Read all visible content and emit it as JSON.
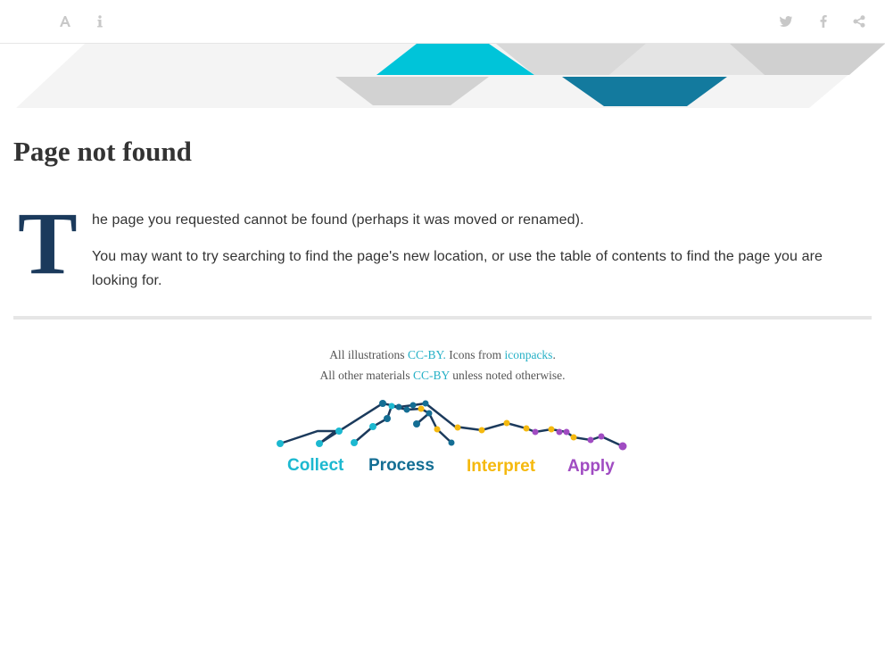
{
  "toolbar": {
    "left_icons": [
      "font-size-icon",
      "info-icon"
    ],
    "right_icons": [
      "twitter-icon",
      "facebook-icon",
      "share-icon"
    ],
    "icon_color": "#c8c8c8"
  },
  "page": {
    "title": "Page not found",
    "dropcap": "T",
    "para1_rest": "he page you requested cannot be found (perhaps it was moved or renamed).",
    "para2": "You may want to try searching to find the page's new location, or use the table of contents to find the page you are looking for."
  },
  "credits": {
    "line1_prefix": "All illustrations ",
    "line1_link1": "CC-BY.",
    "line1_mid": " Icons from ",
    "line1_link2": "iconpacks",
    "line1_suffix": ".",
    "line2_prefix": "All other materials ",
    "line2_link": "CC-BY",
    "line2_suffix": " unless noted otherwise."
  },
  "logo": {
    "words": [
      "Collect",
      "Process",
      "Interpret",
      "Apply"
    ],
    "colors": {
      "collect": "#1cb8d0",
      "process": "#146e94",
      "interpret": "#f5b90f",
      "apply": "#a04cc2",
      "line": "#1b3a5c"
    }
  },
  "colors": {
    "accent": "#25b0c6",
    "dropcap": "#1b3a5c",
    "banner_teal": "#00c4d9",
    "banner_dark": "#137a9e",
    "banner_grey": "#d9d9d9"
  }
}
